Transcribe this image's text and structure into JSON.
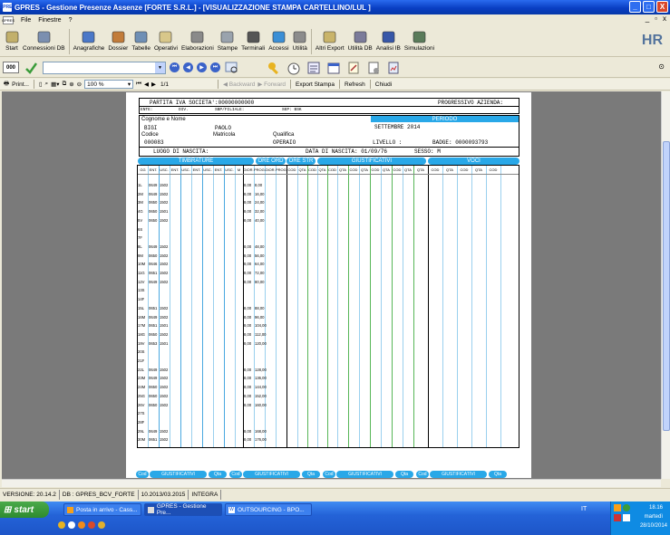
{
  "window": {
    "title": "GPRES - Gestione Presenze Assenze  [FORTE S.R.L.] - [VISUALIZZAZIONE STAMPA CARTELLINO/LUL ]",
    "logo": "GPRES",
    "minimize": "_",
    "maximize": "□",
    "close": "X"
  },
  "menu": {
    "logo": "GPRES",
    "items": [
      "File",
      "Finestre",
      "?"
    ],
    "mdi_min": "_",
    "mdi_restore": "♬",
    "mdi_close": "x"
  },
  "toolbar": {
    "items": [
      {
        "label": "Start",
        "icon": "start-icon"
      },
      {
        "label": "Connessioni DB",
        "icon": "db-icon"
      },
      {
        "label": "Anagrafiche",
        "icon": "people-icon"
      },
      {
        "label": "Dossier",
        "icon": "dossier-icon"
      },
      {
        "label": "Tabelle",
        "icon": "table-icon"
      },
      {
        "label": "Operativi",
        "icon": "clipboard-icon"
      },
      {
        "label": "Elaborazioni",
        "icon": "gear-icon"
      },
      {
        "label": "Stampe",
        "icon": "printer-icon"
      },
      {
        "label": "Terminali",
        "icon": "terminal-icon"
      },
      {
        "label": "Accessi",
        "icon": "access-icon"
      },
      {
        "label": "Utilità",
        "icon": "tools-icon"
      },
      {
        "label": "Altri Export",
        "icon": "export-icon"
      },
      {
        "label": "Utilità DB",
        "icon": "dbtools-icon"
      },
      {
        "label": "Analisi IB",
        "icon": "analysis-icon"
      },
      {
        "label": "Simulazioni",
        "icon": "monitor-icon"
      }
    ],
    "brand": "HR"
  },
  "navbar": {
    "badge": "000",
    "combo_value": "",
    "right_glyph": "⊙"
  },
  "printbar": {
    "print": "Print...",
    "zoom": "100 %",
    "page": "1/1",
    "backward": "Backward",
    "forward": "Forward",
    "export": "Export Stampa",
    "refresh": "Refresh",
    "close": "Chiudi"
  },
  "report": {
    "partita_iva": "PARTITA IVA SOCIETA':00000000000",
    "progressivo": "PROGRESSIVO AZIENDA:",
    "ente": "ENTE:",
    "div": "DIV.",
    "sbp": "SBP/FILIALE:",
    "sep": "SEP: BSK",
    "cognome_label": "Cognome e Nome",
    "cognome": "BIGI",
    "nome": "PAOLO",
    "periodo_label": "PERIODO",
    "periodo": "SETTEMBRE   2014",
    "codice_label": "Codice",
    "matricola_label": "Matricola",
    "qualifica_label": "Qualifica",
    "codice": "000083",
    "qualifica": "OPERAIO",
    "livello": "LIVELLO :",
    "badge": "BADGE: 0000093793",
    "luogo": "LUOGO DI NASCITA:",
    "data_nascita": "DATA DI NASCITA:  01/09/76",
    "sesso": "SESSO:  M",
    "sections": {
      "timbrature": "TIMBRATURE",
      "ore_ord": "ORE ORD",
      "ore_str": "ORE STR",
      "giustificativi": "GIUSTIFICATIVI",
      "voci": "VOCI"
    },
    "col_headers": [
      "GG",
      "ENT.",
      "USC.",
      "ENT.",
      "USC.",
      "ENT.",
      "USC.",
      "ENT.",
      "USC.",
      "M",
      "GIOR.",
      "PROG.",
      "GIOR.",
      "PROG.",
      "COD",
      "QTA",
      "COD",
      "QTA",
      "COD",
      "QTA",
      "COD",
      "QTA",
      "COD",
      "QTA",
      "COD",
      "QTA",
      "QTA",
      "COD",
      "QTA",
      "COD",
      "QTA",
      "COD"
    ],
    "rows": [
      {
        "gg": "1L",
        "ent": "0649",
        "usc": "1502",
        "gior": "8,00",
        "prog": "8,00"
      },
      {
        "gg": "2M",
        "ent": "0649",
        "usc": "1502",
        "gior": "8,00",
        "prog": "16,00"
      },
      {
        "gg": "3M",
        "ent": "0650",
        "usc": "1502",
        "gior": "8,00",
        "prog": "24,00"
      },
      {
        "gg": "4G",
        "ent": "0650",
        "usc": "1501",
        "gior": "8,00",
        "prog": "32,00"
      },
      {
        "gg": "5V",
        "ent": "0650",
        "usc": "1502",
        "gior": "8,00",
        "prog": "40,00"
      },
      {
        "gg": "6S",
        "ent": "",
        "usc": "",
        "gior": "",
        "prog": ""
      },
      {
        "gg": "7F",
        "ent": "",
        "usc": "",
        "gior": "",
        "prog": ""
      },
      {
        "gg": "8L",
        "ent": "0649",
        "usc": "1502",
        "gior": "8,00",
        "prog": "48,00"
      },
      {
        "gg": "9M",
        "ent": "0650",
        "usc": "1502",
        "gior": "8,00",
        "prog": "56,00"
      },
      {
        "gg": "10M",
        "ent": "0646",
        "usc": "1502",
        "gior": "8,00",
        "prog": "64,00"
      },
      {
        "gg": "11G",
        "ent": "0651",
        "usc": "1502",
        "gior": "8,00",
        "prog": "72,00"
      },
      {
        "gg": "12V",
        "ent": "0649",
        "usc": "1502",
        "gior": "8,00",
        "prog": "80,00"
      },
      {
        "gg": "13S",
        "ent": "",
        "usc": "",
        "gior": "",
        "prog": ""
      },
      {
        "gg": "14F",
        "ent": "",
        "usc": "",
        "gior": "",
        "prog": ""
      },
      {
        "gg": "15L",
        "ent": "0651",
        "usc": "1502",
        "gior": "8,00",
        "prog": "88,00"
      },
      {
        "gg": "16M",
        "ent": "0649",
        "usc": "1502",
        "gior": "8,00",
        "prog": "96,00"
      },
      {
        "gg": "17M",
        "ent": "0651",
        "usc": "1501",
        "gior": "8,00",
        "prog": "104,00"
      },
      {
        "gg": "18G",
        "ent": "0650",
        "usc": "1502",
        "gior": "8,00",
        "prog": "112,00"
      },
      {
        "gg": "19V",
        "ent": "0653",
        "usc": "1501",
        "gior": "8,00",
        "prog": "120,00"
      },
      {
        "gg": "20S",
        "ent": "",
        "usc": "",
        "gior": "",
        "prog": ""
      },
      {
        "gg": "21F",
        "ent": "",
        "usc": "",
        "gior": "",
        "prog": ""
      },
      {
        "gg": "22L",
        "ent": "0649",
        "usc": "1502",
        "gior": "8,00",
        "prog": "128,00"
      },
      {
        "gg": "23M",
        "ent": "0649",
        "usc": "1502",
        "gior": "8,00",
        "prog": "136,00"
      },
      {
        "gg": "24M",
        "ent": "0650",
        "usc": "1502",
        "gior": "8,00",
        "prog": "144,00"
      },
      {
        "gg": "25G",
        "ent": "0650",
        "usc": "1502",
        "gior": "8,00",
        "prog": "152,00"
      },
      {
        "gg": "26V",
        "ent": "0650",
        "usc": "1502",
        "gior": "8,00",
        "prog": "160,00"
      },
      {
        "gg": "27S",
        "ent": "",
        "usc": "",
        "gior": "",
        "prog": ""
      },
      {
        "gg": "28F",
        "ent": "",
        "usc": "",
        "gior": "",
        "prog": ""
      },
      {
        "gg": "29L",
        "ent": "0649",
        "usc": "1502",
        "gior": "8,00",
        "prog": "168,00"
      },
      {
        "gg": "30M",
        "ent": "0651",
        "usc": "1502",
        "gior": "8,00",
        "prog": "176,00"
      }
    ]
  },
  "footer_pills": [
    {
      "cod": "Cod",
      "giu": "GIUSTIFICATIVI",
      "qta": "Qta"
    },
    {
      "cod": "Cod",
      "giu": "GIUSTIFICATIVI",
      "qta": "Qta"
    },
    {
      "cod": "Cod",
      "giu": "GIUSTIFICATIVI",
      "qta": "Qta"
    },
    {
      "cod": "Cod",
      "giu": "GIUSTIFICATIVI",
      "qta": "Qta"
    }
  ],
  "statusbar": [
    "VERSIONE: 20.14.2",
    "DB : GPRES_BCV_FORTE",
    "10.2013/03.2015",
    "INTEGRA"
  ],
  "taskbar": {
    "start": "start",
    "tasks": [
      "Posta in arrivo - Cass...",
      "GPRES - Gestione Pre...",
      "OUTSOURCING - BPO..."
    ],
    "lang": "IT",
    "time": "18.16",
    "day": "martedì",
    "date": "28/10/2014"
  },
  "colors": {
    "accent": "#29a8e8",
    "titlebar": "#0a3fc4",
    "taskbar": "#2463d8",
    "start": "#3a9c3a"
  }
}
